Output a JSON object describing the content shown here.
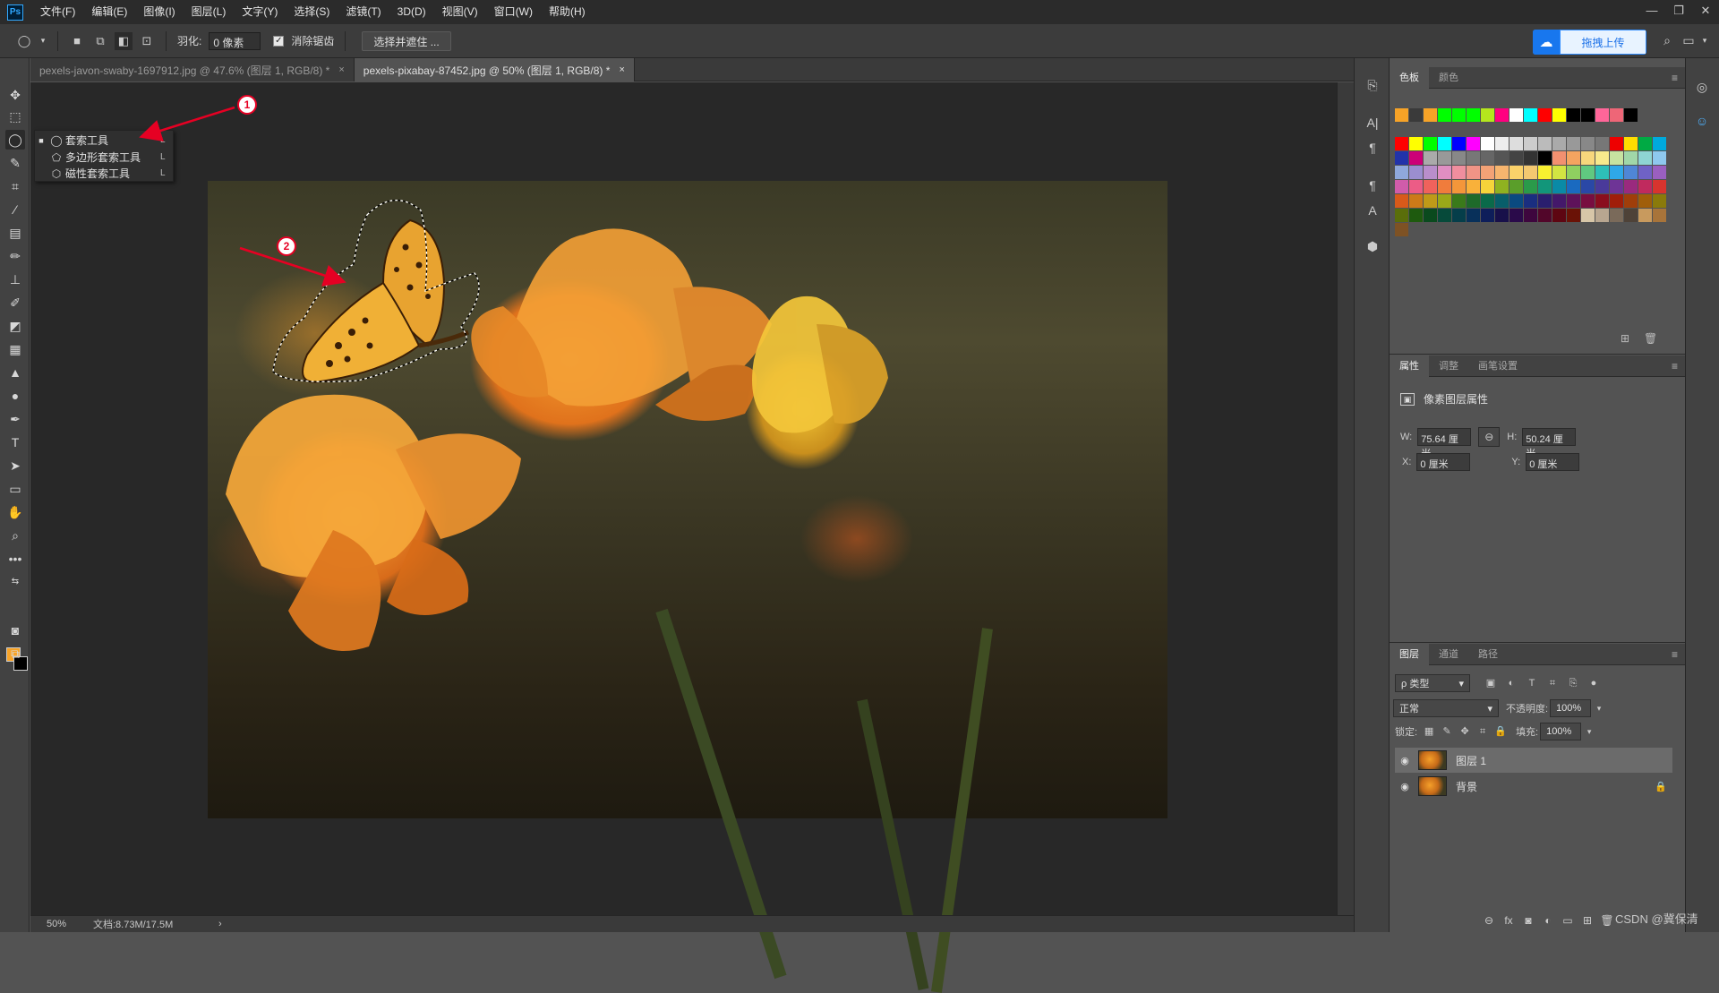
{
  "app": {
    "logo": "Ps"
  },
  "menubar": {
    "items": [
      "文件(F)",
      "编辑(E)",
      "图像(I)",
      "图层(L)",
      "文字(Y)",
      "选择(S)",
      "滤镜(T)",
      "3D(D)",
      "视图(V)",
      "窗口(W)",
      "帮助(H)"
    ],
    "window_controls": [
      "—",
      "❐",
      "✕"
    ]
  },
  "options": {
    "feather_label": "羽化:",
    "feather_value": "0 像素",
    "antialias_label": "消除锯齿",
    "antialias_checked": true,
    "select_mask_label": "选择并遮住 ...",
    "upload_label": "拖拽上传"
  },
  "tabs": [
    {
      "label": "pexels-javon-swaby-1697912.jpg @ 47.6% (图层 1, RGB/8) *",
      "close": "×",
      "active": false
    },
    {
      "label": "pexels-pixabay-87452.jpg @ 50% (图层 1, RGB/8) *",
      "close": "×",
      "active": true
    }
  ],
  "flyout": {
    "items": [
      {
        "label": "套索工具",
        "key": "L",
        "selected": true
      },
      {
        "label": "多边形套索工具",
        "key": "L",
        "selected": false
      },
      {
        "label": "磁性套索工具",
        "key": "L",
        "selected": false
      }
    ]
  },
  "annotations": {
    "badge1": "1",
    "badge2": "2"
  },
  "status": {
    "zoom": "50%",
    "doc": "文档:8.73M/17.5M",
    "arrow": "›"
  },
  "panels": {
    "swatches": {
      "tabs": [
        "色板",
        "颜色"
      ],
      "recent": [
        "#f7a327",
        "#3a3a3a",
        "#f7a327",
        "#00ff00",
        "#00ff00",
        "#00ff00",
        "#b5e61d",
        "#ff0080",
        "#ffffff",
        "#00ffff",
        "#ff0000",
        "#ffff00",
        "#000000",
        "#000000",
        "#ff6699",
        "#ee6677",
        "#000000"
      ],
      "grid": [
        "#ff0000",
        "#ffff00",
        "#00ff00",
        "#00ffff",
        "#0000ff",
        "#ff00ff",
        "#ffffff",
        "#eeeeee",
        "#dddddd",
        "#cccccc",
        "#bbbbbb",
        "#aaaaaa",
        "#999999",
        "#888888",
        "#777777",
        "#ee0000",
        "#ffdd00",
        "#00aa44",
        "#00aadd",
        "#2233aa",
        "#cc0077",
        "#aaaaaa",
        "#999999",
        "#888888",
        "#777777",
        "#666666",
        "#555555",
        "#444444",
        "#333333",
        "#000000",
        "#f29070",
        "#f4a460",
        "#f7d77c",
        "#f7e98c",
        "#c7e3a0",
        "#a0d7a8",
        "#8ed5d3",
        "#8ec8ee",
        "#8fa8dc",
        "#9b8ed0",
        "#b98ecb",
        "#e08ec2",
        "#f08e9e",
        "#f09486",
        "#f3a276",
        "#f7b56e",
        "#fbd26a",
        "#f4c870",
        "#f8f030",
        "#d2e442",
        "#8fd060",
        "#60c880",
        "#2ebfb8",
        "#2fa8e8",
        "#4f86d6",
        "#6f62c6",
        "#9a5fc0",
        "#d05caa",
        "#ec5c86",
        "#f0625c",
        "#f07c3c",
        "#f4963a",
        "#f9b13a",
        "#f6d43a",
        "#8fb220",
        "#5a9e2a",
        "#2a9a4a",
        "#12967a",
        "#0a8aa6",
        "#1a6ac0",
        "#2a48a6",
        "#4a3a9a",
        "#6e3496",
        "#9a2a7e",
        "#c02a5e",
        "#d8342e",
        "#d85a1a",
        "#cc7a18",
        "#bf9a18",
        "#9aa818",
        "#3a7a1a",
        "#1e6a2a",
        "#0a6a4a",
        "#085e6a",
        "#0a4a80",
        "#1a2e80",
        "#2a1e6e",
        "#44186a",
        "#5e125a",
        "#780e40",
        "#8a0e1e",
        "#a01e0a",
        "#a03e0a",
        "#a05e0a",
        "#8a7a0a",
        "#5a6e0a",
        "#1e5a0e",
        "#0a4a1e",
        "#064a3a",
        "#053e4a",
        "#08305a",
        "#0e1e5a",
        "#18104a",
        "#2a0a4a",
        "#3e063e",
        "#52062a",
        "#5e0612",
        "#6a1206",
        "#d7c6a8",
        "#b8a690",
        "#7a6a5a",
        "#4e4238",
        "#c89a5e",
        "#a8743a",
        "#7e5224"
      ]
    },
    "properties": {
      "tabs": [
        "属性",
        "调整",
        "画笔设置"
      ],
      "header": "像素图层属性",
      "w_label": "W:",
      "w_value": "75.64 厘米",
      "h_label": "H:",
      "h_value": "50.24 厘米",
      "x_label": "X:",
      "x_value": "0 厘米",
      "y_label": "Y:",
      "y_value": "0 厘米"
    },
    "layers": {
      "tabs": [
        "图层",
        "通道",
        "路径"
      ],
      "filter": "ρ 类型",
      "blend_mode": "正常",
      "opacity_label": "不透明度:",
      "opacity_value": "100%",
      "lock_label": "锁定:",
      "fill_label": "填充:",
      "fill_value": "100%",
      "rows": [
        {
          "name": "图层 1",
          "selected": true,
          "locked": false
        },
        {
          "name": "背景",
          "selected": false,
          "locked": true
        }
      ]
    }
  },
  "watermark": "CSDN @冀保清"
}
